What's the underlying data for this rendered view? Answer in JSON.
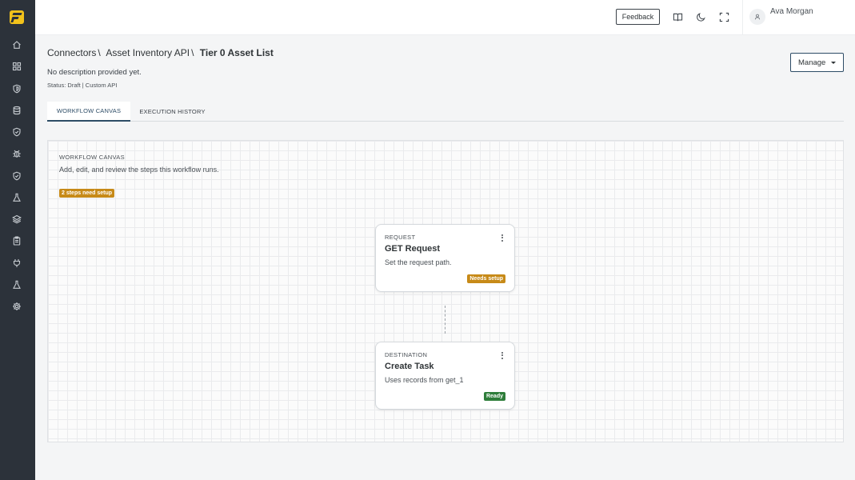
{
  "topbar": {
    "feedback_label": "Feedback",
    "icons": [
      "book-icon",
      "moon-icon",
      "fullscreen-icon"
    ],
    "user_name": "Ava Morgan"
  },
  "sidebar": {
    "items": [
      {
        "icon": "home-icon"
      },
      {
        "icon": "grid-icon"
      },
      {
        "icon": "shield-icon"
      },
      {
        "icon": "database-icon"
      },
      {
        "icon": "shield-check-icon"
      },
      {
        "icon": "bug-icon"
      },
      {
        "icon": "shield-check-icon"
      },
      {
        "icon": "flask-icon"
      },
      {
        "icon": "layers-icon"
      },
      {
        "icon": "clipboard-icon"
      },
      {
        "icon": "plug-icon"
      },
      {
        "icon": "flask-icon"
      },
      {
        "icon": "settings-icon"
      }
    ]
  },
  "header": {
    "breadcrumb": [
      "Connectors",
      "Asset Inventory API",
      "Tier 0 Asset List"
    ],
    "breadcrumb_separator": "\\",
    "description": "No description provided yet.",
    "status_line": "Status: Draft | Custom API",
    "manage_label": "Manage"
  },
  "tabs": [
    {
      "label": "WORKFLOW CANVAS",
      "active": true
    },
    {
      "label": "EXECUTION HISTORY",
      "active": false
    }
  ],
  "canvas": {
    "title": "WORKFLOW CANVAS",
    "subtitle": "Add, edit, and review the steps this workflow runs.",
    "setup_badge": "2 steps need setup",
    "nodes": [
      {
        "type": "REQUEST",
        "title": "GET Request",
        "description": "Set the request path.",
        "badge": "Needs setup",
        "badge_color": "#c78a18"
      },
      {
        "type": "DESTINATION",
        "title": "Create Task",
        "description": "Uses records from get_1",
        "badge": "Ready",
        "badge_color": "#2e7d3a"
      }
    ]
  },
  "colors": {
    "sidebar_bg": "#2c323a",
    "accent": "#2d4c66",
    "logo": "#f2c21b",
    "warning": "#c78a18",
    "success": "#2e7d3a"
  }
}
